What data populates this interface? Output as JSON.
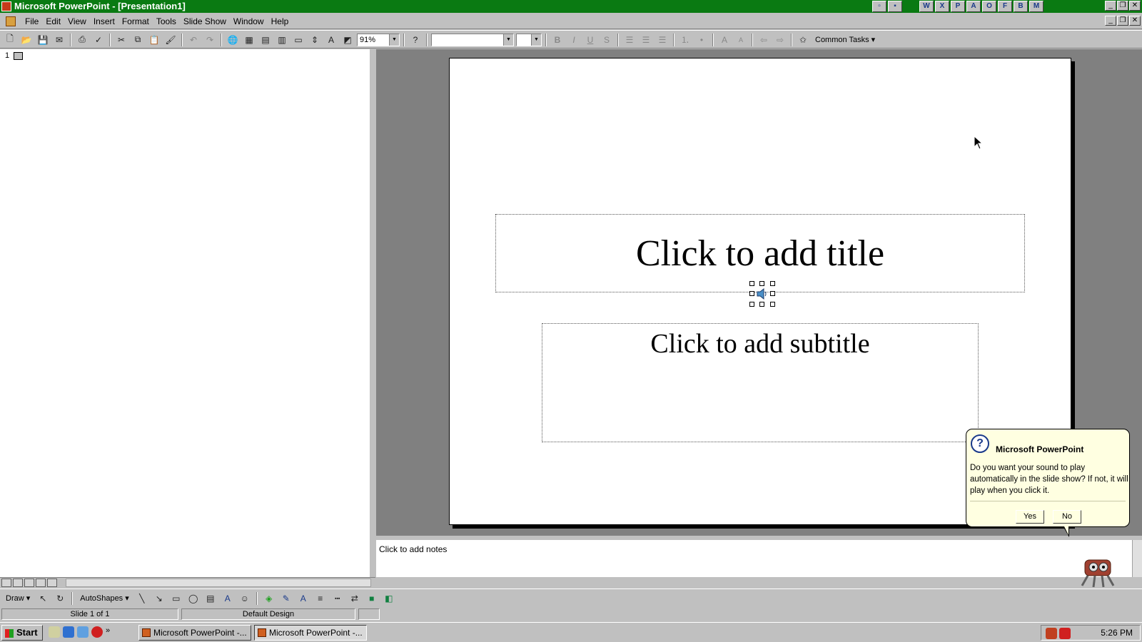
{
  "window": {
    "title": "Microsoft PowerPoint - [Presentation1]"
  },
  "office_shortcuts": [
    "W",
    "X",
    "P",
    "A",
    "O",
    "F",
    "B",
    "M"
  ],
  "menu": [
    "File",
    "Edit",
    "View",
    "Insert",
    "Format",
    "Tools",
    "Slide Show",
    "Window",
    "Help"
  ],
  "toolbar": {
    "zoom": "91%",
    "font_name": "",
    "font_size": "",
    "common_tasks_label": "Common Tasks ▾"
  },
  "outline": {
    "slide_number": "1"
  },
  "slide": {
    "title_placeholder": "Click to add title",
    "subtitle_placeholder": "Click to add subtitle"
  },
  "notes": {
    "placeholder": "Click to add notes"
  },
  "balloon": {
    "title": "Microsoft PowerPoint",
    "message": "Do you want your sound to play automatically in the slide show? If not, it will play when you click it.",
    "yes_label": "Yes",
    "no_label": "No"
  },
  "drawbar": {
    "draw_label": "Draw ▾",
    "autoshapes_label": "AutoShapes ▾"
  },
  "status": {
    "slide": "Slide 1 of 1",
    "design": "Default Design"
  },
  "taskbar": {
    "start_label": "Start",
    "task1": "Microsoft PowerPoint -...",
    "task2": "Microsoft PowerPoint -...",
    "clock": "5:26 PM"
  },
  "colors": {
    "titlebar": "#0a7a12",
    "balloon_bg": "#ffffe1",
    "workspace": "#808080"
  }
}
